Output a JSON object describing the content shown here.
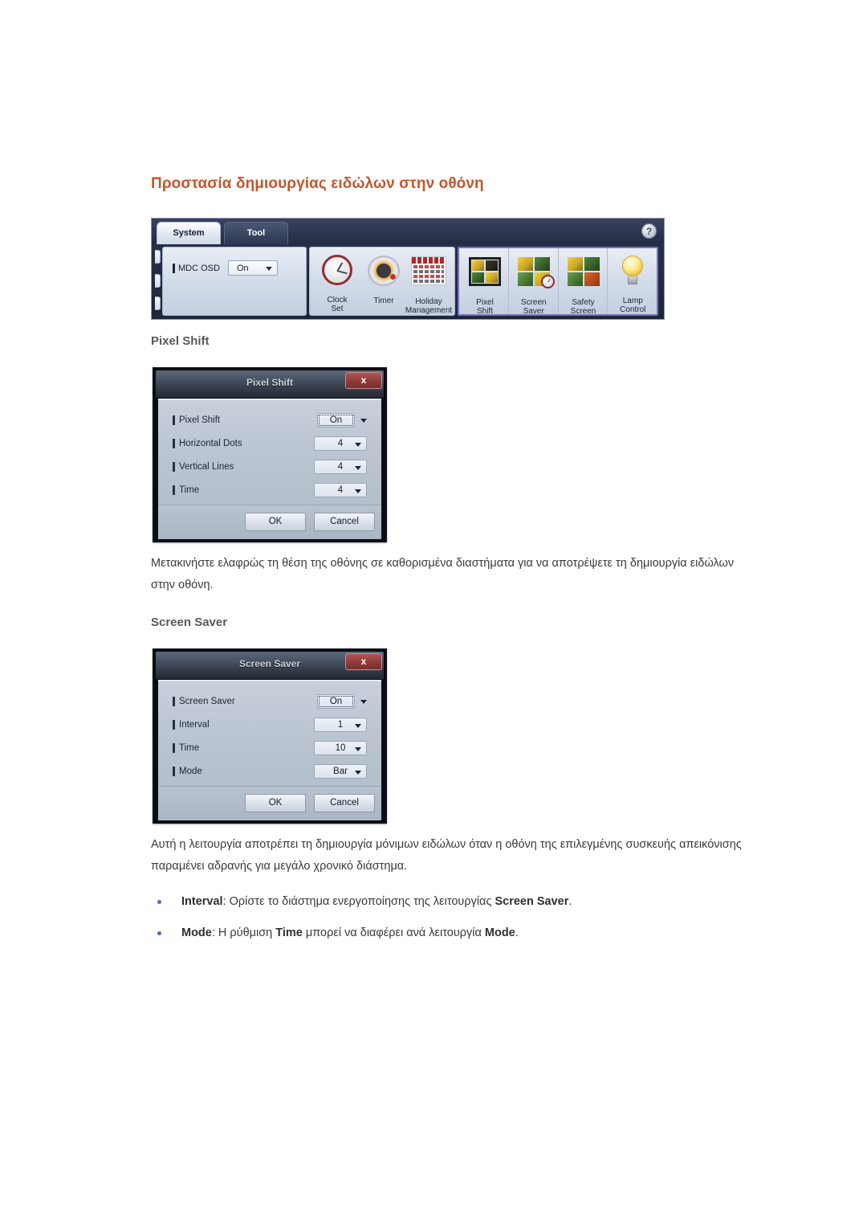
{
  "document": {
    "title": "Προστασία δημιουργίας ειδώλων στην οθόνη"
  },
  "mdc_toolbar": {
    "tabs": [
      {
        "label": "System",
        "active": true
      },
      {
        "label": "Tool",
        "active": false
      }
    ],
    "help_icon": "?",
    "osd": {
      "label": "MDC OSD",
      "value": "On"
    },
    "buttons": [
      {
        "icon": "clock-icon",
        "line1": "Clock",
        "line2": "Set"
      },
      {
        "icon": "timer-icon",
        "line1": "Timer",
        "line2": ""
      },
      {
        "icon": "calendar-icon",
        "line1": "Holiday",
        "line2": "Management"
      },
      {
        "icon": "pixel-shift-icon",
        "line1": "Pixel",
        "line2": "Shift"
      },
      {
        "icon": "screen-saver-icon",
        "line1": "Screen",
        "line2": "Saver"
      },
      {
        "icon": "safety-screen-icon",
        "line1": "Safety",
        "line2": "Screen"
      },
      {
        "icon": "lamp-icon",
        "line1": "Lamp",
        "line2": "Control"
      }
    ],
    "highlight_color": "#7a6fbe"
  },
  "sections": {
    "pixel_shift": {
      "heading": "Pixel Shift",
      "dialog": {
        "title": "Pixel Shift",
        "close_label": "x",
        "fields": [
          {
            "label": "Pixel Shift",
            "value": "On",
            "focused": true
          },
          {
            "label": "Horizontal Dots",
            "value": "4",
            "focused": false
          },
          {
            "label": "Vertical Lines",
            "value": "4",
            "focused": false
          },
          {
            "label": "Time",
            "value": "4",
            "focused": false
          }
        ],
        "ok_label": "OK",
        "cancel_label": "Cancel"
      },
      "paragraph": "Μετακινήστε ελαφρώς τη θέση της οθόνης σε καθορισμένα διαστήματα για να αποτρέψετε τη δημιουργία ειδώλων στην οθόνη."
    },
    "screen_saver": {
      "heading": "Screen Saver",
      "dialog": {
        "title": "Screen Saver",
        "close_label": "x",
        "fields": [
          {
            "label": "Screen Saver",
            "value": "On",
            "focused": true
          },
          {
            "label": "Interval",
            "value": "1",
            "focused": false
          },
          {
            "label": "Time",
            "value": "10",
            "focused": false
          },
          {
            "label": "Mode",
            "value": "Bar",
            "focused": false
          }
        ],
        "ok_label": "OK",
        "cancel_label": "Cancel"
      },
      "paragraph": "Αυτή η λειτουργία αποτρέπει τη δημιουργία μόνιμων ειδώλων όταν η οθόνη της επιλεγμένης συσκευής απεικόνισης παραμένει αδρανής για μεγάλο χρονικό διάστημα.",
      "bullets": [
        {
          "term": "Interval",
          "text_before": ": Ορίστε το διάστημα ενεργοποίησης της λειτουργίας ",
          "term2": "Screen Saver",
          "text_after": "."
        },
        {
          "term": "Mode",
          "text_before": ": Η ρύθμιση ",
          "term2": "Time",
          "text_mid": " μπορεί να διαφέρει ανά λειτουργία ",
          "term3": "Mode",
          "text_after": "."
        }
      ]
    }
  },
  "colors": {
    "title": "#C4562B",
    "heading": "#58585A",
    "bullet": "#4A72B3",
    "body_text": "#3A3A3C"
  }
}
